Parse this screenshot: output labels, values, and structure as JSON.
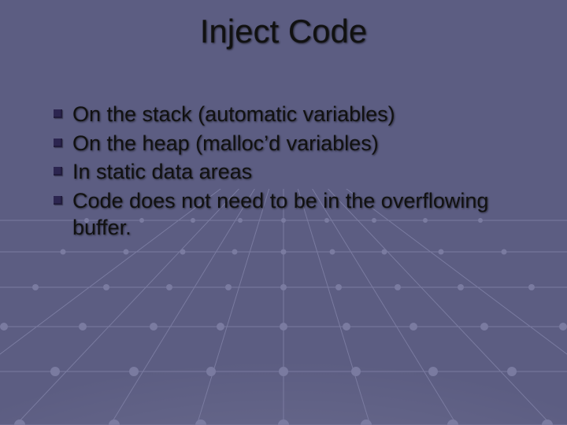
{
  "title": "Inject Code",
  "bullets": [
    "On the stack (automatic variables)",
    "On the heap (malloc’d variables)",
    "In static data areas",
    "Code does not need to be in the overflowing buffer."
  ]
}
